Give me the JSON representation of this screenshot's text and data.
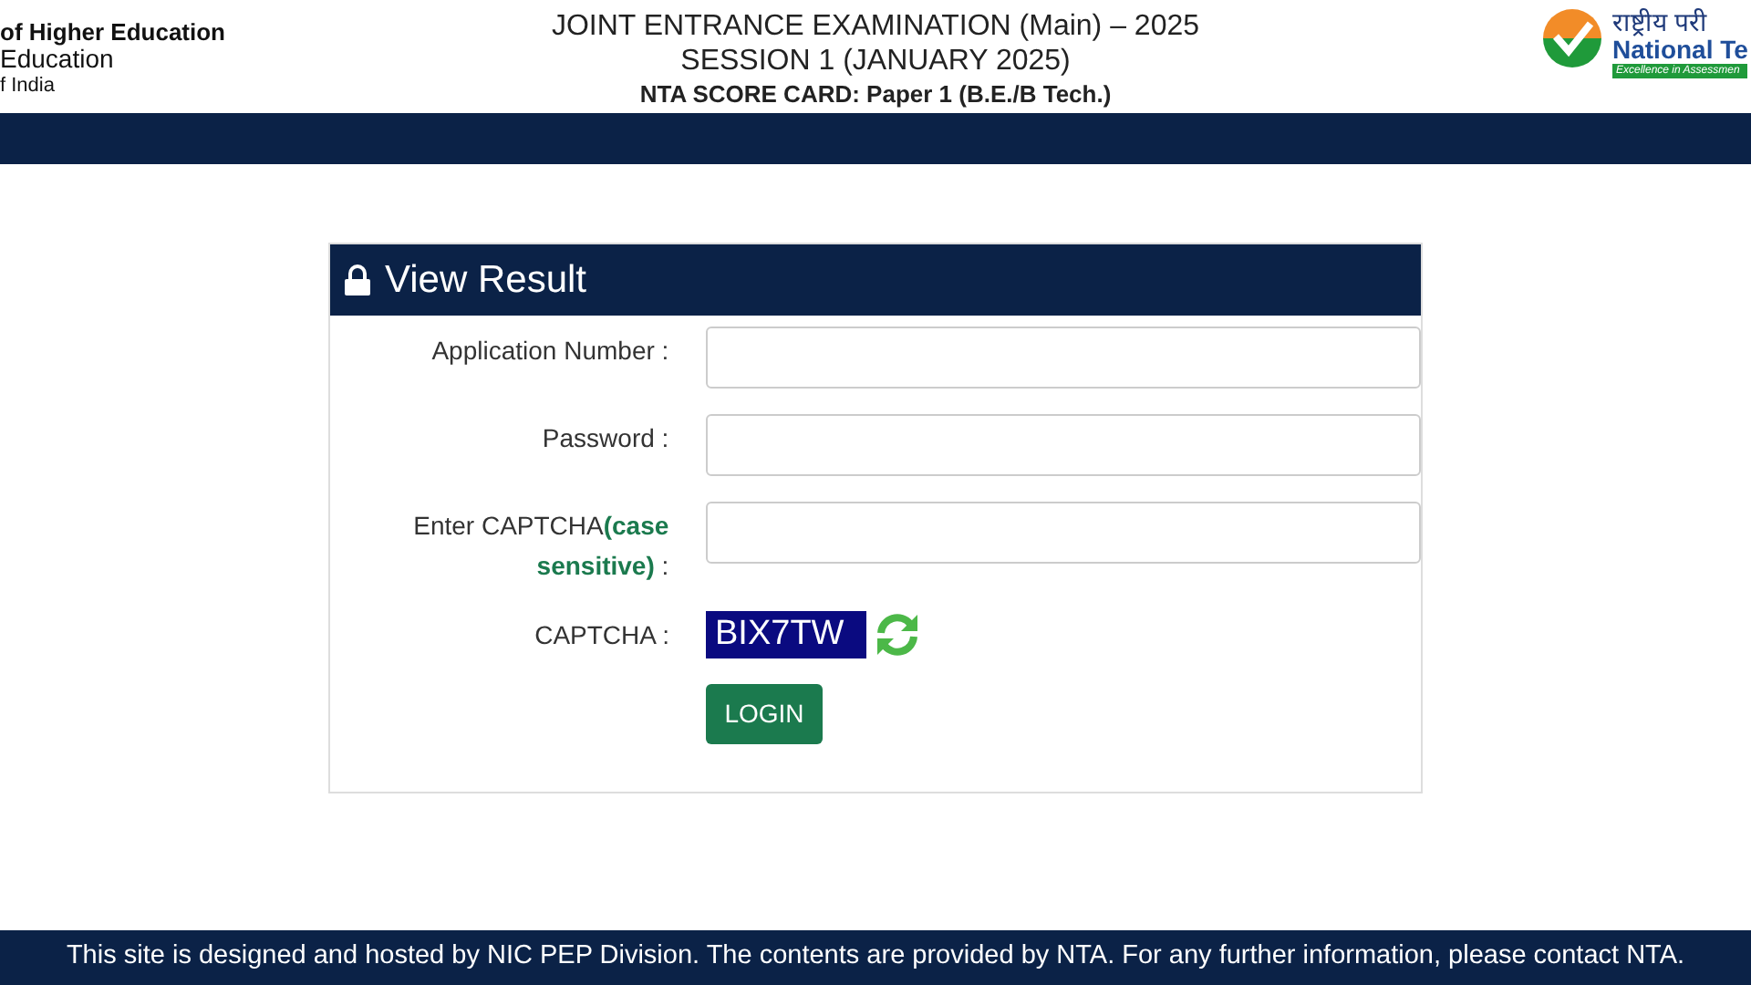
{
  "header": {
    "left_lines": [
      "of Higher Education",
      "Education",
      "f India"
    ],
    "title_lines": [
      "JOINT ENTRANCE EXAMINATION (Main) – 2025",
      "SESSION 1 (JANUARY 2025)",
      "NTA SCORE CARD: Paper 1 (B.E./B Tech.)"
    ],
    "logo": {
      "hindi": "राष्ट्रीय परी",
      "english": "National Te",
      "tagline": "Excellence in Assessmen"
    }
  },
  "panel": {
    "title": "View Result",
    "fields": [
      {
        "kind": "input",
        "label": "Application Number :"
      },
      {
        "kind": "input",
        "label": "Password :"
      },
      {
        "kind": "input",
        "label": "Enter CAPTCHA**(case sensitive)** :"
      },
      {
        "kind": "captcha",
        "label": "CAPTCHA :",
        "value": "BIX7TW"
      }
    ],
    "button": "LOGIN"
  },
  "footer": "This site is designed and hosted by NIC PEP Division. The contents are provided by NTA. For any further information, please contact NTA."
}
